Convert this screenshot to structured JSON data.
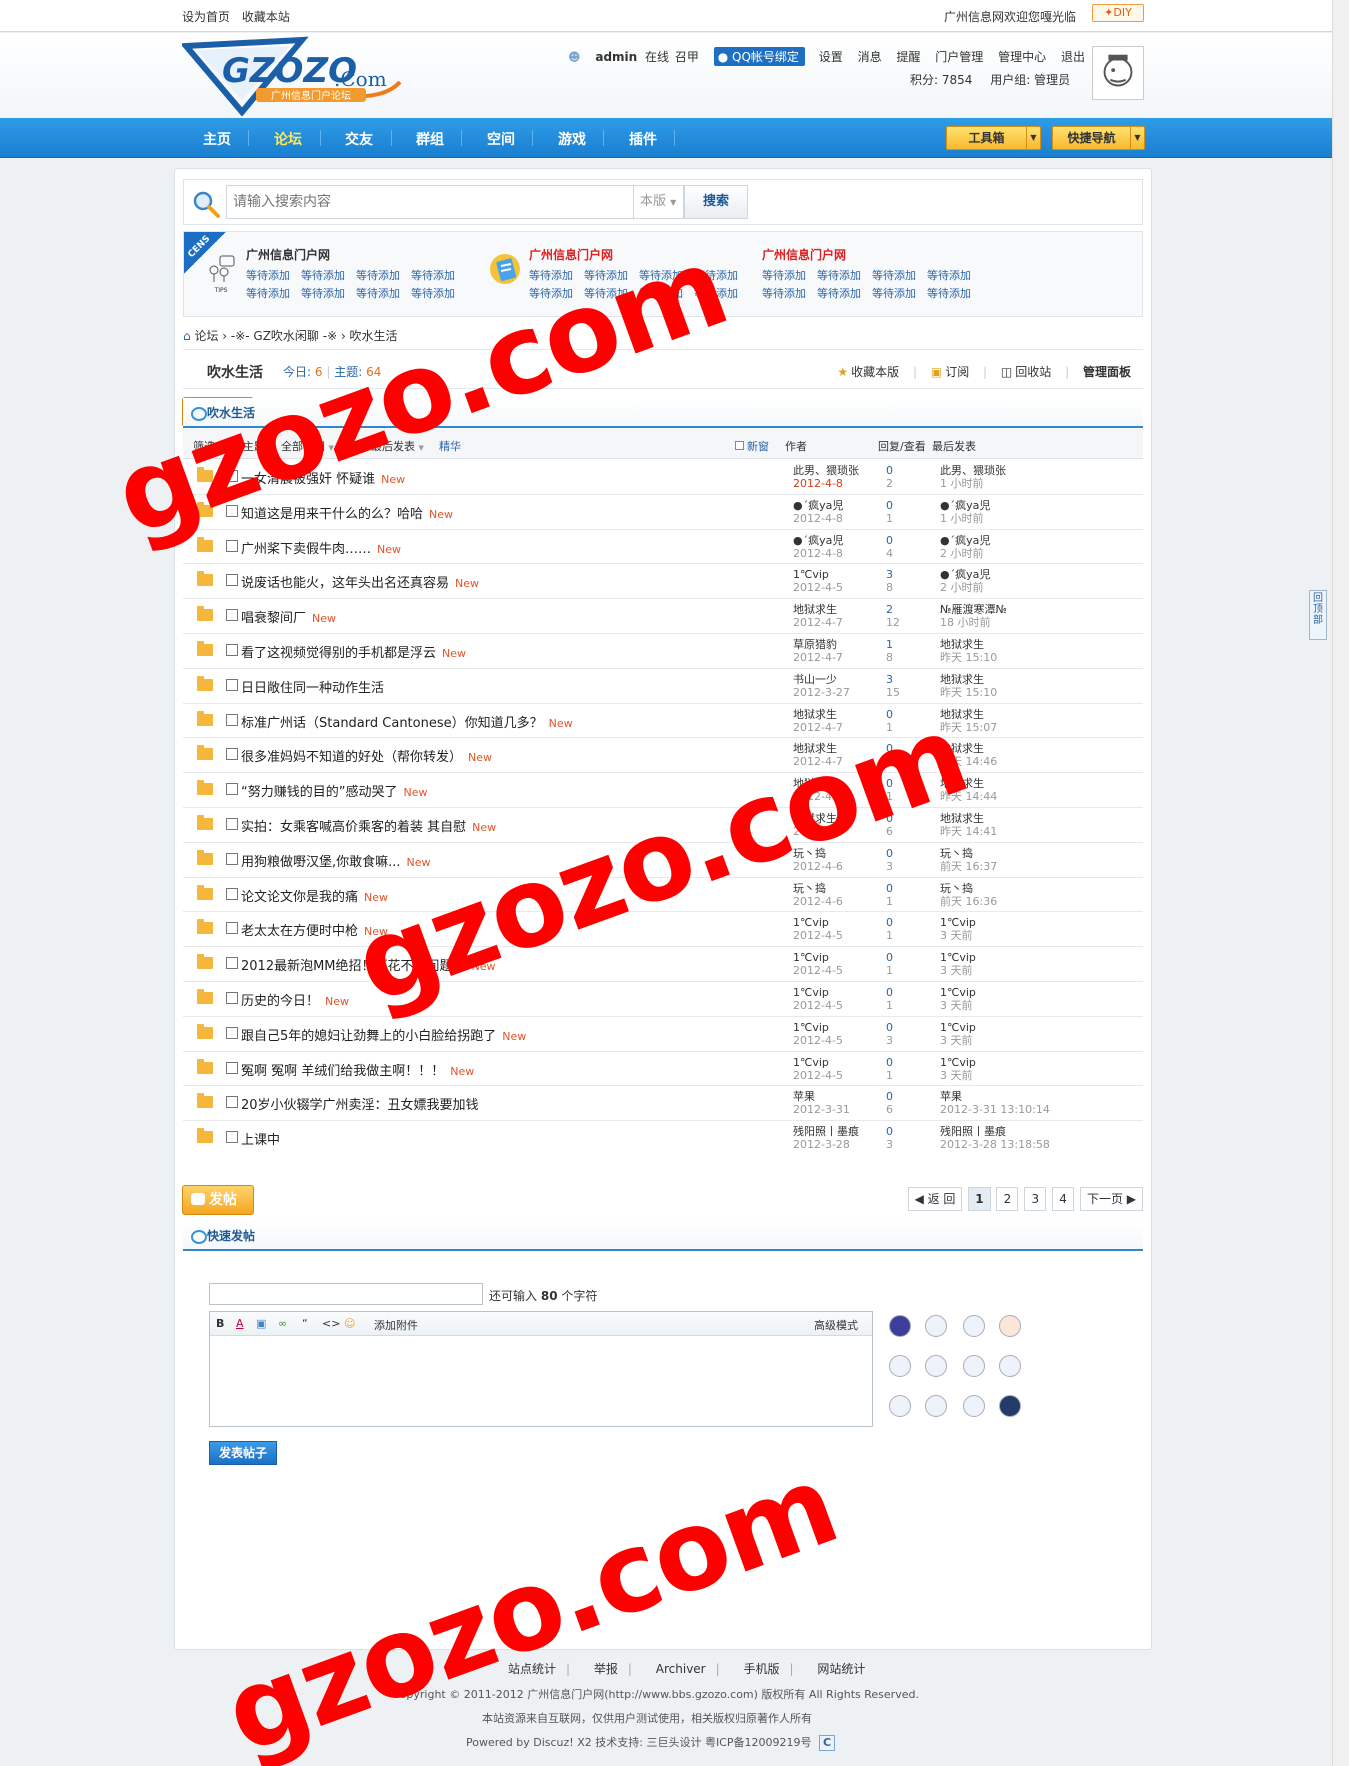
{
  "topbar": {
    "set_home": "设为首页",
    "bookmark": "收藏本站",
    "welcome": "广州信息网欢迎您嘎光临",
    "diy": "✦DIY"
  },
  "header": {
    "logo_text": "GZOZO.Com",
    "logo_sub": "广州信息门户论坛",
    "username": "admin",
    "status": "在线",
    "status_extra": "召甲",
    "qq_bind": "QQ帐号绑定",
    "links": [
      "设置",
      "消息",
      "提醒",
      "门户管理",
      "管理中心",
      "退出"
    ],
    "points": "积分: 7854",
    "usergroup": "用户组: 管理员"
  },
  "nav": {
    "items": [
      "主页",
      "论坛",
      "交友",
      "群组",
      "空间",
      "游戏",
      "插件"
    ],
    "active": "论坛",
    "toolbox": "工具箱",
    "quicknav": "快捷导航"
  },
  "search": {
    "placeholder": "请输入搜索内容",
    "scope": "本版",
    "button": "搜索"
  },
  "ads": {
    "corner": "CENS",
    "tips": "TIPS",
    "group1_title": "广州信息门户网",
    "group2_title": "广州信息门户网",
    "group3_title": "广州信息门户网",
    "pending": "等待添加"
  },
  "breadcrumb": {
    "text": "论坛 › -※- GZ吹水闲聊 -※ › 吹水生活"
  },
  "forum": {
    "name": "吹水生活",
    "today_label": "今日:",
    "today": "6",
    "topics_label": "主题:",
    "topics": "64",
    "tools": [
      "收藏本版",
      "订阅",
      "回收站",
      "管理面板"
    ]
  },
  "post_button": "发帖",
  "pager": {
    "back": "返 回",
    "pages": [
      "1",
      "2",
      "3",
      "4"
    ],
    "next": "下一页"
  },
  "list_title": "吹水生活",
  "filter": {
    "label": "筛选:",
    "all_topics": "全部主题",
    "all_time": "全部时间",
    "sort_label": "排序:",
    "sort": "最后发表",
    "digest": "精华",
    "new_window": "新窗",
    "col_author": "作者",
    "col_reply": "回复/查看",
    "col_last": "最后发表"
  },
  "threads": [
    {
      "title": "一女清晨被强奸 怀疑谁",
      "new": true,
      "author": "此男、猥琐张",
      "date": "2012-4-8",
      "replies": "0",
      "views": "2",
      "last_user": "此男、猥琐张",
      "last_time": "1 小时前"
    },
    {
      "title": "知道这是用来干什么的么？哈哈",
      "new": true,
      "author": "●´疯ya児",
      "date": "2012-4-8",
      "replies": "0",
      "views": "1",
      "last_user": "●´疯ya児",
      "last_time": "1 小时前"
    },
    {
      "title": "广州桨下卖假牛肉……",
      "new": true,
      "author": "●´疯ya児",
      "date": "2012-4-8",
      "replies": "0",
      "views": "4",
      "last_user": "●´疯ya児",
      "last_time": "2 小时前"
    },
    {
      "title": "说废话也能火，这年头出名还真容易",
      "new": true,
      "author": "1℃vip",
      "date": "2012-4-5",
      "replies": "3",
      "views": "8",
      "last_user": "●´疯ya児",
      "last_time": "2 小时前"
    },
    {
      "title": "唱衰黎间厂",
      "new": true,
      "author": "地狱求生",
      "date": "2012-4-7",
      "replies": "2",
      "views": "12",
      "last_user": "№雁渡寒潭№",
      "last_time": "18 小时前"
    },
    {
      "title": "看了这视频觉得别的手机都是浮云",
      "new": true,
      "author": "草原猎豹",
      "date": "2012-4-7",
      "replies": "1",
      "views": "8",
      "last_user": "地狱求生",
      "last_time": "昨天 15:10"
    },
    {
      "title": "日日敞住同一种动作生活",
      "new": false,
      "author": "书山一少",
      "date": "2012-3-27",
      "replies": "3",
      "views": "15",
      "last_user": "地狱求生",
      "last_time": "昨天 15:10"
    },
    {
      "title": "标准广州话（Standard Cantonese）你知道几多？",
      "new": true,
      "author": "地狱求生",
      "date": "2012-4-7",
      "replies": "0",
      "views": "1",
      "last_user": "地狱求生",
      "last_time": "昨天 15:07"
    },
    {
      "title": "很多准妈妈不知道的好处（帮你转发）",
      "new": true,
      "author": "地狱求生",
      "date": "2012-4-7",
      "replies": "0",
      "views": "2",
      "last_user": "地狱求生",
      "last_time": "昨天 14:46"
    },
    {
      "title": "“努力赚钱的目的”感动哭了",
      "new": true,
      "author": "地狱求生",
      "date": "2012-4-7",
      "replies": "0",
      "views": "1",
      "last_user": "地狱求生",
      "last_time": "昨天 14:44"
    },
    {
      "title": "实拍：女乘客喊高价乘客的着装 其自慰",
      "new": true,
      "author": "地狱求生",
      "date": "2012-4-7",
      "replies": "0",
      "views": "6",
      "last_user": "地狱求生",
      "last_time": "昨天 14:41"
    },
    {
      "title": "用狗粮做嘢汉堡,你敢食嘛...",
      "new": true,
      "author": "玩丶捣",
      "date": "2012-4-6",
      "replies": "0",
      "views": "3",
      "last_user": "玩丶捣",
      "last_time": "前天 16:37"
    },
    {
      "title": "论文论文你是我的痛",
      "new": true,
      "author": "玩丶捣",
      "date": "2012-4-6",
      "replies": "0",
      "views": "1",
      "last_user": "玩丶捣",
      "last_time": "前天 16:36"
    },
    {
      "title": "老太太在方便时中枪",
      "new": true,
      "author": "1℃vip",
      "date": "2012-4-5",
      "replies": "0",
      "views": "1",
      "last_user": "1℃vip",
      "last_time": "3 天前"
    },
    {
      "title": "2012最新泡MM绝招！斑花不是问题！",
      "new": true,
      "author": "1℃vip",
      "date": "2012-4-5",
      "replies": "0",
      "views": "1",
      "last_user": "1℃vip",
      "last_time": "3 天前"
    },
    {
      "title": "历史的今日！",
      "new": true,
      "author": "1℃vip",
      "date": "2012-4-5",
      "replies": "0",
      "views": "1",
      "last_user": "1℃vip",
      "last_time": "3 天前"
    },
    {
      "title": "跟自己5年的媳妇让劲舞上的小白脸给拐跑了",
      "new": true,
      "author": "1℃vip",
      "date": "2012-4-5",
      "replies": "0",
      "views": "3",
      "last_user": "1℃vip",
      "last_time": "3 天前"
    },
    {
      "title": "冤啊 冤啊 羊绒们给我做主啊！！！",
      "new": true,
      "author": "1℃vip",
      "date": "2012-4-5",
      "replies": "0",
      "views": "1",
      "last_user": "1℃vip",
      "last_time": "3 天前"
    },
    {
      "title": "20岁小伙辍学广州卖淫：丑女嫖我要加钱",
      "new": false,
      "author": "苹果",
      "date": "2012-3-31",
      "replies": "0",
      "views": "6",
      "last_user": "苹果",
      "last_time": "2012-3-31 13:10:14"
    },
    {
      "title": "上课中",
      "new": false,
      "author": "残阳照丨墨痕",
      "date": "2012-3-28",
      "replies": "0",
      "views": "3",
      "last_user": "残阳照丨墨痕",
      "last_time": "2012-3-28 13:18:58"
    }
  ],
  "new_label": "New",
  "quick_post": {
    "title": "快速发帖",
    "remaining_prefix": "还可输入",
    "remaining": "80",
    "remaining_suffix": "个字符",
    "attach": "添加附件",
    "advanced": "高级模式",
    "submit": "发表帖子"
  },
  "footer": {
    "links": [
      "站点统计",
      "举报",
      "Archiver",
      "手机版",
      "网站统计"
    ],
    "copyright": "Copyright © 2011-2012 广州信息门户网(http://www.bbs.gzozo.com) 版权所有 All Rights Reserved.",
    "notice": "本站资源来自互联网，仅供用户测试使用，相关版权归原著作人所有",
    "powered": "Powered by Discuz! X2  技术支持: 三巨头设计 粤ICP备12009219号"
  },
  "scroll_top": "回顶部",
  "watermark": "gzozo.com",
  "colors": {
    "nav_blue": "#1a7fd0",
    "watermark_red": "#ff0000",
    "new_orange": "#e0552a"
  }
}
